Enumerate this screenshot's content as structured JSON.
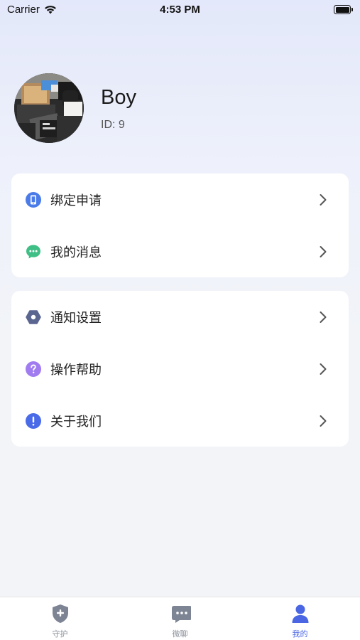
{
  "status_bar": {
    "carrier": "Carrier",
    "time": "4:53 PM"
  },
  "profile": {
    "name": "Boy",
    "id_text": "ID: 9"
  },
  "menu_group1": [
    {
      "label": "绑定申请",
      "icon": "phone-icon",
      "color": "#4a7be8"
    },
    {
      "label": "我的消息",
      "icon": "chat-icon",
      "color": "#3fbf86"
    }
  ],
  "menu_group2": [
    {
      "label": "通知设置",
      "icon": "hexagon-settings-icon",
      "color": "#5a6590"
    },
    {
      "label": "操作帮助",
      "icon": "help-icon",
      "color": "#a07cf0"
    },
    {
      "label": "关于我们",
      "icon": "info-icon",
      "color": "#4a6be8"
    }
  ],
  "tabbar": {
    "tabs": [
      {
        "label": "守护",
        "icon": "shield-plus-icon"
      },
      {
        "label": "微聊",
        "icon": "chat-bubble-icon"
      },
      {
        "label": "我的",
        "icon": "person-icon"
      }
    ],
    "active_index": 2,
    "active_color": "#4a66e3",
    "inactive_color": "#7d8494"
  }
}
